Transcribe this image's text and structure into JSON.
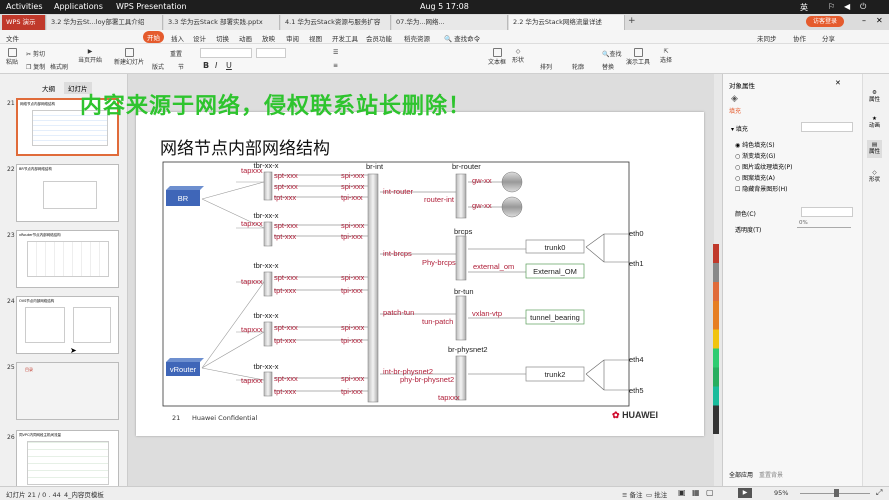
{
  "topbar": {
    "activities": "Activities",
    "applications": "Applications",
    "app_name": "WPS Presentation",
    "datetime": "Aug 5  17:08",
    "lang": "英"
  },
  "tabs": [
    {
      "label": "WPS 演示"
    },
    {
      "label": "3.2 华为云St...loy部署工具介绍"
    },
    {
      "label": "3.3 华为云Stack 部署实践.pptx"
    },
    {
      "label": "4.1 华为云Stack资源与服务扩容"
    },
    {
      "label": "07.华为...网络..."
    },
    {
      "label": "2.2 华为云Stack网络流量详述"
    }
  ],
  "login_button": "访客登录",
  "menu": [
    "文件",
    "开始",
    "插入",
    "设计",
    "切换",
    "动画",
    "放映",
    "审阅",
    "视图",
    "开发工具",
    "会员功能",
    "稻壳资源",
    "查找命令"
  ],
  "ribbon": {
    "buttons": [
      "粘贴",
      "剪切",
      "复制",
      "格式刷",
      "当页开始",
      "新建幻灯片",
      "版式",
      "节",
      "重置",
      "文本框",
      "形状",
      "排列",
      "轮廓",
      "替换",
      "演示工具",
      "选择",
      "查找"
    ]
  },
  "right_top": {
    "unsync": "未同步",
    "collab": "协作",
    "share": "分享"
  },
  "left_panel": {
    "tabs": [
      "大纲",
      "幻灯片"
    ],
    "thumbs": [
      {
        "num": "21",
        "title": "网络节点内部网络结构"
      },
      {
        "num": "22",
        "title": "BR节点内部网络结构"
      },
      {
        "num": "23",
        "title": "vRouter节点内部网络结构"
      },
      {
        "num": "24",
        "title": "OVS节点内部网络结构"
      },
      {
        "num": "25",
        "title": "目录"
      },
      {
        "num": "26",
        "title": "同VPC内同网段主机间流量"
      }
    ]
  },
  "watermark": "内容来源于网络，侵权联系站长删除！",
  "slide": {
    "title": "网络节点内部网络结构",
    "page_num": "21",
    "confidential": "Huawei Confidential",
    "logo_text": "HUAWEI",
    "nodes": {
      "br": "BR",
      "vrouter": "vRouter",
      "br_int": "br-int",
      "br_router": "br-router",
      "brcps": "brcps",
      "br_tun": "br-tun",
      "br_physnet2": "br-physnet2",
      "trunk0": "trunk0",
      "external_om": "External_OM",
      "tunnel_bearing": "tunnel_bearing",
      "trunk2": "trunk2",
      "eth0": "eth0",
      "eth1": "eth1",
      "eth4": "eth4",
      "eth5": "eth5",
      "tbr": "tbr-xx-x",
      "tapxxx": "tapxxx",
      "spt": "spt-xxx",
      "tpt": "tpt-xxx",
      "spi": "spi-xxx",
      "tpi": "tpi-xxx",
      "int_router": "int-router",
      "router_int": "router-int",
      "gw": "gw-xx",
      "int_brcps": "int-brcps",
      "phy_brcps": "Phy-brcps",
      "external_om_port": "external_om",
      "patch_tun": "patch-tun",
      "tun_patch": "tun-patch",
      "vxlan_vtp": "vxlan-vtp",
      "int_br_physnet2": "int-br-physnet2",
      "phy_br_physnet2": "phy-br-physnet2"
    }
  },
  "right_panel": {
    "title": "对象属性",
    "tab_fill": "填充",
    "section_fill": "填充",
    "options": [
      "纯色填充(S)",
      "渐变填充(G)",
      "图片或纹理填充(P)",
      "图案填充(A)",
      "隐藏背景图形(H)"
    ],
    "color_label": "颜色(C)",
    "transparency_label": "透明度(T)",
    "transparency_value": "0%",
    "apply_all": "全部应用",
    "reset_bg": "重置背景"
  },
  "sidebar": [
    "属性",
    "动画",
    "属性",
    "形状"
  ],
  "status": {
    "slide_info": "幻灯片 21 / 0 . 44",
    "template": "4_内容页模板",
    "notes": "备注",
    "comment": "批注",
    "zoom": "95%"
  }
}
